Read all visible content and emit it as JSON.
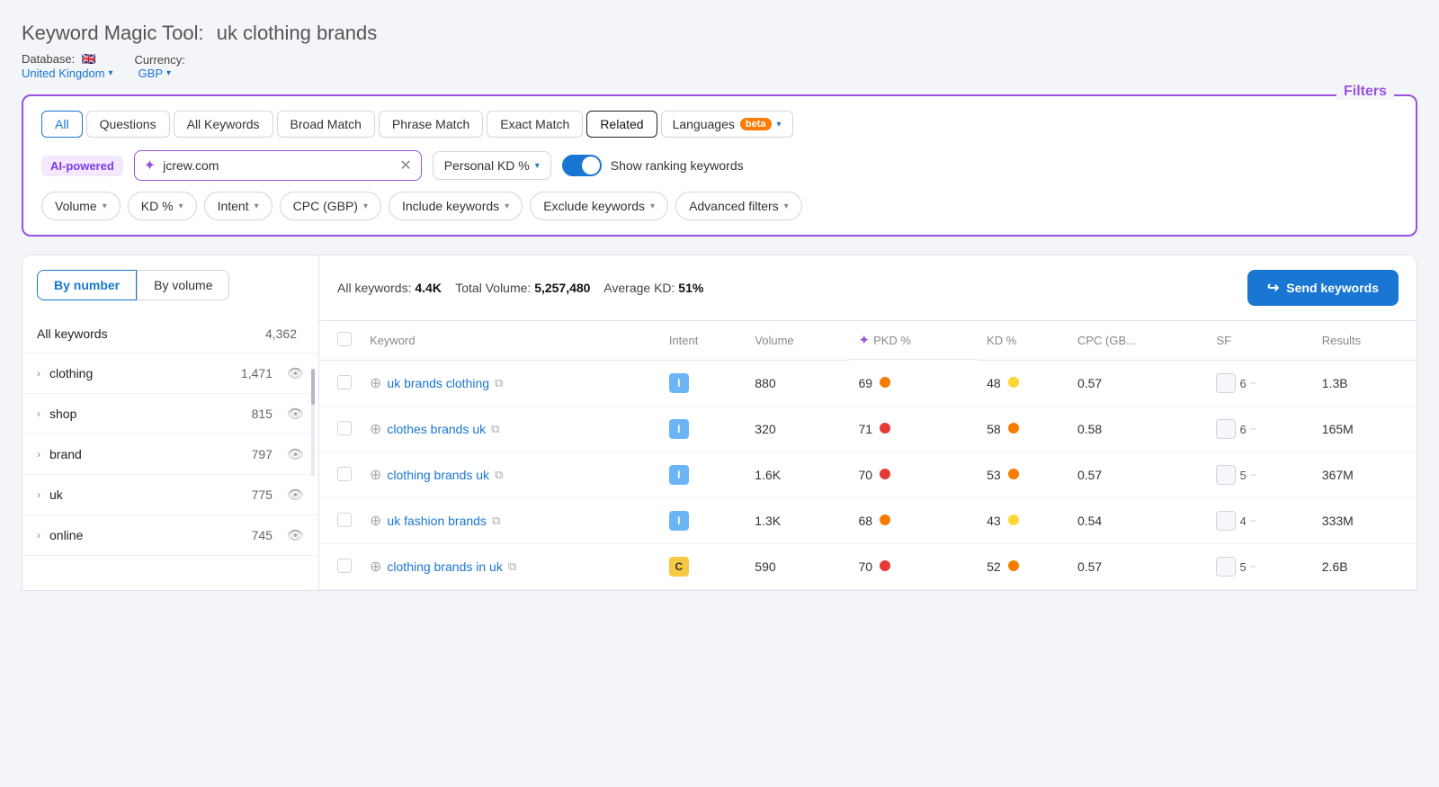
{
  "header": {
    "tool_name": "Keyword Magic Tool:",
    "query": "uk clothing brands",
    "database_label": "Database:",
    "database_flag": "🇬🇧",
    "database_value": "United Kingdom",
    "currency_label": "Currency:",
    "currency_value": "GBP"
  },
  "filters_label": "Filters",
  "tabs": [
    {
      "label": "All",
      "active": true
    },
    {
      "label": "Questions"
    },
    {
      "label": "All Keywords"
    },
    {
      "label": "Broad Match"
    },
    {
      "label": "Phrase Match"
    },
    {
      "label": "Exact Match"
    },
    {
      "label": "Related",
      "selected": true
    },
    {
      "label": "Languages",
      "has_beta": true,
      "has_chevron": true
    }
  ],
  "ai_row": {
    "badge": "AI-powered",
    "input_value": "jcrew.com",
    "input_placeholder": "jcrew.com",
    "kd_btn": "Personal KD %",
    "toggle_label": "Show ranking keywords"
  },
  "filter_buttons": [
    {
      "label": "Volume"
    },
    {
      "label": "KD %"
    },
    {
      "label": "Intent"
    },
    {
      "label": "CPC (GBP)"
    },
    {
      "label": "Include keywords"
    },
    {
      "label": "Exclude keywords"
    },
    {
      "label": "Advanced filters"
    }
  ],
  "sidebar": {
    "tab_by_number": "By number",
    "tab_by_volume": "By volume",
    "items": [
      {
        "label": "All keywords",
        "count": "4,362",
        "has_chevron": false
      },
      {
        "label": "clothing",
        "count": "1,471",
        "has_chevron": true
      },
      {
        "label": "shop",
        "count": "815",
        "has_chevron": true
      },
      {
        "label": "brand",
        "count": "797",
        "has_chevron": true
      },
      {
        "label": "uk",
        "count": "775",
        "has_chevron": true
      },
      {
        "label": "online",
        "count": "745",
        "has_chevron": true
      }
    ]
  },
  "table": {
    "stats": {
      "all_keywords_label": "All keywords:",
      "all_keywords_value": "4.4K",
      "total_volume_label": "Total Volume:",
      "total_volume_value": "5,257,480",
      "avg_kd_label": "Average KD:",
      "avg_kd_value": "51%"
    },
    "send_btn": "Send keywords",
    "columns": [
      "Keyword",
      "Intent",
      "Volume",
      "PKD %",
      "KD %",
      "CPC (GB...",
      "SF",
      "Results"
    ],
    "rows": [
      {
        "keyword": "uk brands clothing",
        "intent": "I",
        "intent_type": "i",
        "volume": "880",
        "pkd": "69",
        "pkd_dot": "orange",
        "kd": "48",
        "kd_dot": "yellow",
        "cpc": "0.57",
        "sf": "6",
        "results": "1.3B"
      },
      {
        "keyword": "clothes brands uk",
        "intent": "I",
        "intent_type": "i",
        "volume": "320",
        "pkd": "71",
        "pkd_dot": "red",
        "kd": "58",
        "kd_dot": "orange",
        "cpc": "0.58",
        "sf": "6",
        "results": "165M"
      },
      {
        "keyword": "clothing brands uk",
        "intent": "I",
        "intent_type": "i",
        "volume": "1.6K",
        "pkd": "70",
        "pkd_dot": "red",
        "kd": "53",
        "kd_dot": "orange",
        "cpc": "0.57",
        "sf": "5",
        "results": "367M"
      },
      {
        "keyword": "uk fashion brands",
        "intent": "I",
        "intent_type": "i",
        "volume": "1.3K",
        "pkd": "68",
        "pkd_dot": "orange",
        "kd": "43",
        "kd_dot": "yellow",
        "cpc": "0.54",
        "sf": "4",
        "results": "333M"
      },
      {
        "keyword": "clothing brands in uk",
        "intent": "C",
        "intent_type": "c",
        "volume": "590",
        "pkd": "70",
        "pkd_dot": "red",
        "kd": "52",
        "kd_dot": "orange",
        "cpc": "0.57",
        "sf": "5",
        "results": "2.6B"
      }
    ]
  }
}
